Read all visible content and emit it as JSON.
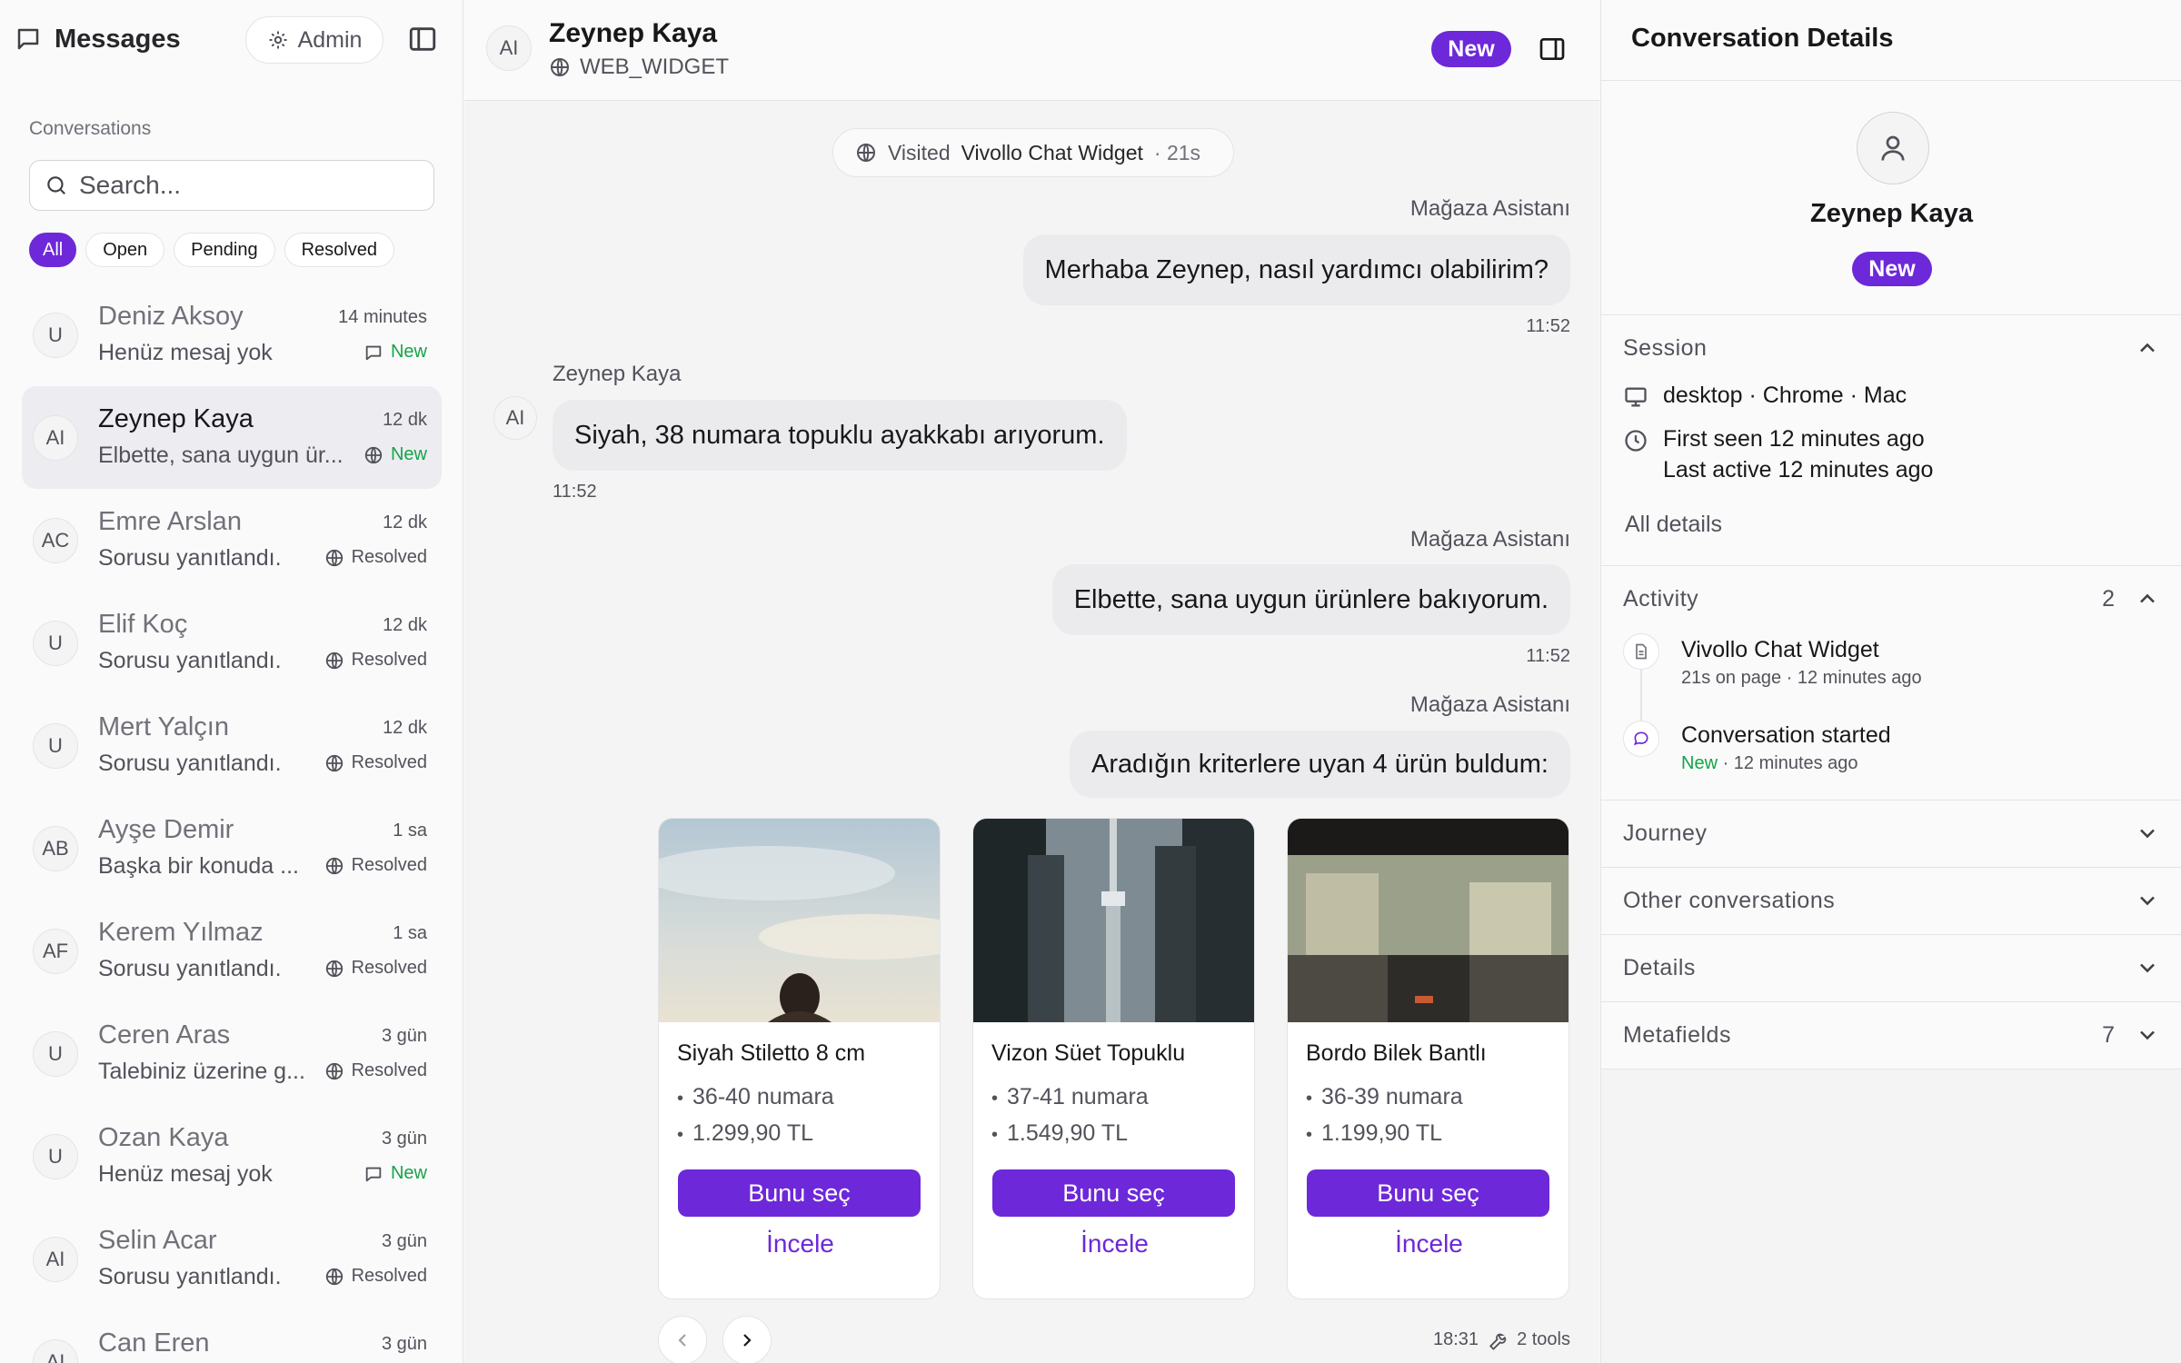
{
  "sidebar": {
    "title": "Messages",
    "admin_label": "Admin",
    "section_label": "Conversations",
    "search_placeholder": "Search...",
    "filters": [
      "All",
      "Open",
      "Pending",
      "Resolved"
    ],
    "conversations": [
      {
        "initials": "U",
        "name": "Deniz Aksoy",
        "time": "14 minutes",
        "preview": "Henüz mesaj yok",
        "status": "New",
        "status_icon": "chat-icon"
      },
      {
        "initials": "AI",
        "name": "Zeynep Kaya",
        "time": "12 dk",
        "preview": "Elbette, sana uygun ür...",
        "status": "New",
        "status_icon": "globe-icon"
      },
      {
        "initials": "AC",
        "name": "Emre Arslan",
        "time": "12 dk",
        "preview": "Sorusu yanıtlandı.",
        "status": "Resolved",
        "status_icon": "globe-icon"
      },
      {
        "initials": "U",
        "name": "Elif Koç",
        "time": "12 dk",
        "preview": "Sorusu yanıtlandı.",
        "status": "Resolved",
        "status_icon": "globe-icon"
      },
      {
        "initials": "U",
        "name": "Mert Yalçın",
        "time": "12 dk",
        "preview": "Sorusu yanıtlandı.",
        "status": "Resolved",
        "status_icon": "globe-icon"
      },
      {
        "initials": "AB",
        "name": "Ayşe Demir",
        "time": "1 sa",
        "preview": "Başka bir konuda ...",
        "status": "Resolved",
        "status_icon": "globe-icon"
      },
      {
        "initials": "AF",
        "name": "Kerem Yılmaz",
        "time": "1 sa",
        "preview": "Sorusu yanıtlandı.",
        "status": "Resolved",
        "status_icon": "globe-icon"
      },
      {
        "initials": "U",
        "name": "Ceren Aras",
        "time": "3 gün",
        "preview": "Talebiniz üzerine g...",
        "status": "Resolved",
        "status_icon": "globe-icon"
      },
      {
        "initials": "U",
        "name": "Ozan Kaya",
        "time": "3 gün",
        "preview": "Henüz mesaj yok",
        "status": "New",
        "status_icon": "chat-icon"
      },
      {
        "initials": "AI",
        "name": "Selin Acar",
        "time": "3 gün",
        "preview": "Sorusu yanıtlandı.",
        "status": "Resolved",
        "status_icon": "globe-icon"
      },
      {
        "initials": "AI",
        "name": "Can Eren",
        "time": "3 gün",
        "preview": "",
        "status": "",
        "status_icon": ""
      }
    ]
  },
  "chat": {
    "avatar": "AI",
    "contact_name": "Zeynep Kaya",
    "channel": "WEB_WIDGET",
    "status_badge": "New",
    "visited": {
      "prefix": "Visited",
      "page": "Vivollo Chat Widget",
      "duration": "· 21s"
    },
    "messages": [
      {
        "sender": "Mağaza Asistanı",
        "text": "Merhaba Zeynep, nasıl yardımcı olabilirim?",
        "time": "11:52"
      },
      {
        "sender": "Zeynep Kaya",
        "avatar": "AI",
        "text": "Siyah, 38 numara topuklu ayakkabı arıyorum.",
        "time": "11:52"
      },
      {
        "sender": "Mağaza Asistanı",
        "text": "Elbette, sana uygun ürünlere bakıyorum.",
        "time": "11:52"
      },
      {
        "sender": "Mağaza Asistanı",
        "text": "Aradığın kriterlere uyan 4 ürün buldum:"
      }
    ],
    "products": [
      {
        "title": "Siyah Stiletto 8 cm",
        "size": "36-40 numara",
        "price": "1.299,90 TL",
        "select": "Bunu seç",
        "view": "İncele"
      },
      {
        "title": "Vizon Süet Topuklu",
        "size": "37-41 numara",
        "price": "1.549,90 TL",
        "select": "Bunu seç",
        "view": "İncele"
      },
      {
        "title": "Bordo Bilek Bantlı",
        "size": "36-39 numara",
        "price": "1.199,90 TL",
        "select": "Bunu seç",
        "view": "İncele"
      }
    ],
    "footer_time": "18:31",
    "footer_tools": "2 tools"
  },
  "details": {
    "title": "Conversation Details",
    "name": "Zeynep Kaya",
    "badge": "New",
    "session": {
      "title": "Session",
      "device": "desktop · Chrome · Mac",
      "first_seen": "First seen 12 minutes ago",
      "last_active": "Last active 12 minutes ago",
      "all_details": "All details"
    },
    "activity": {
      "title": "Activity",
      "count": "2",
      "items": [
        {
          "title": "Vivollo Chat Widget",
          "sub": "21s on page · 12 minutes ago"
        },
        {
          "title": "Conversation started",
          "sub_status": "New",
          "sub": " · 12 minutes ago"
        }
      ]
    },
    "journey": "Journey",
    "other": "Other conversations",
    "details_label": "Details",
    "metafields": "Metafields",
    "metafields_count": "7"
  },
  "colors": {
    "accent": "#6d28d9",
    "new_green": "#16a34a",
    "border": "#e4e4e7"
  }
}
